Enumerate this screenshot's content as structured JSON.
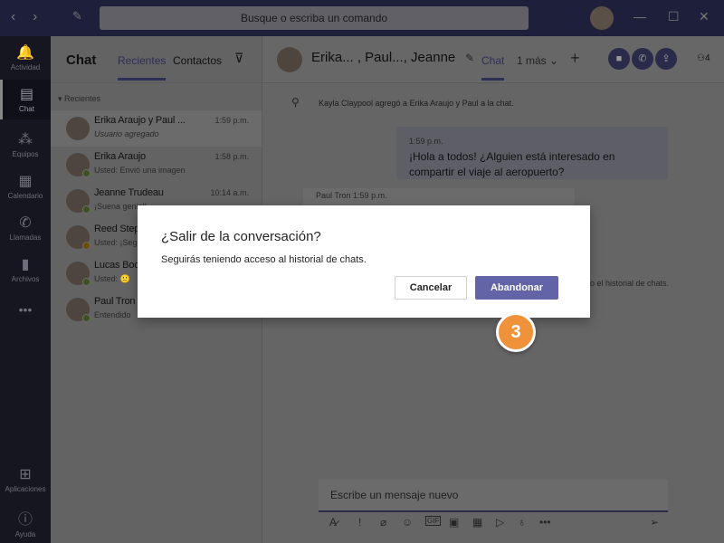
{
  "titlebar": {
    "search_placeholder": "Busque o escriba un comando"
  },
  "rail": [
    {
      "label": "Actividad",
      "icon": "bell-icon"
    },
    {
      "label": "Chat",
      "icon": "chat-icon"
    },
    {
      "label": "Equipos",
      "icon": "teams-icon"
    },
    {
      "label": "Calendario",
      "icon": "calendar-icon"
    },
    {
      "label": "Llamadas",
      "icon": "phone-icon"
    },
    {
      "label": "Archivos",
      "icon": "file-icon"
    },
    {
      "label": "Aplicaciones",
      "icon": "apps-icon"
    },
    {
      "label": "Ayuda",
      "icon": "help-icon"
    }
  ],
  "list": {
    "title": "Chat",
    "tabs": [
      "Recientes",
      "Contactos"
    ],
    "section": "Recientes",
    "items": [
      {
        "name": "Erika Araujo y Paul ...",
        "time": "1:59 p.m.",
        "preview": "Usuario agregado"
      },
      {
        "name": "Erika Araujo",
        "time": "1:58 p.m.",
        "preview": "Usted: Envió una imagen"
      },
      {
        "name": "Jeanne Trudeau",
        "time": "10:14 a.m.",
        "preview": "¡Suena genial!"
      },
      {
        "name": "Reed Step",
        "time": "",
        "preview": "Usted: ¡Seg"
      },
      {
        "name": "Lucas Boo",
        "time": "",
        "preview": "Usted: 🙂"
      },
      {
        "name": "Paul Tron",
        "time": "",
        "preview": "Entendido"
      }
    ]
  },
  "main": {
    "title": "Erika... , Paul..., Jeanne",
    "tab": "Chat",
    "more": "1 más",
    "participants": "4",
    "system_message": "Kayla Claypool agregó a Erika Araujo y Paul a la chat.",
    "msg1": {
      "time": "1:59 p.m.",
      "text": "¡Hola a todos! ¿Alguien está interesado en compartir el viaje al aeropuerto?"
    },
    "msg2": {
      "author": "Paul Tron",
      "time": "1:59 p.m."
    },
    "msg3_partial": "o el historial de chats.",
    "compose_placeholder": "Escribe un mensaje nuevo"
  },
  "dialog": {
    "title": "¿Salir de la conversación?",
    "body": "Seguirás teniendo acceso al historial de chats.",
    "cancel": "Cancelar",
    "confirm": "Abandonar"
  },
  "step_badge": "3",
  "colors": {
    "accent": "#6264a7",
    "badge": "#f0923a",
    "titlebar": "#464775"
  }
}
